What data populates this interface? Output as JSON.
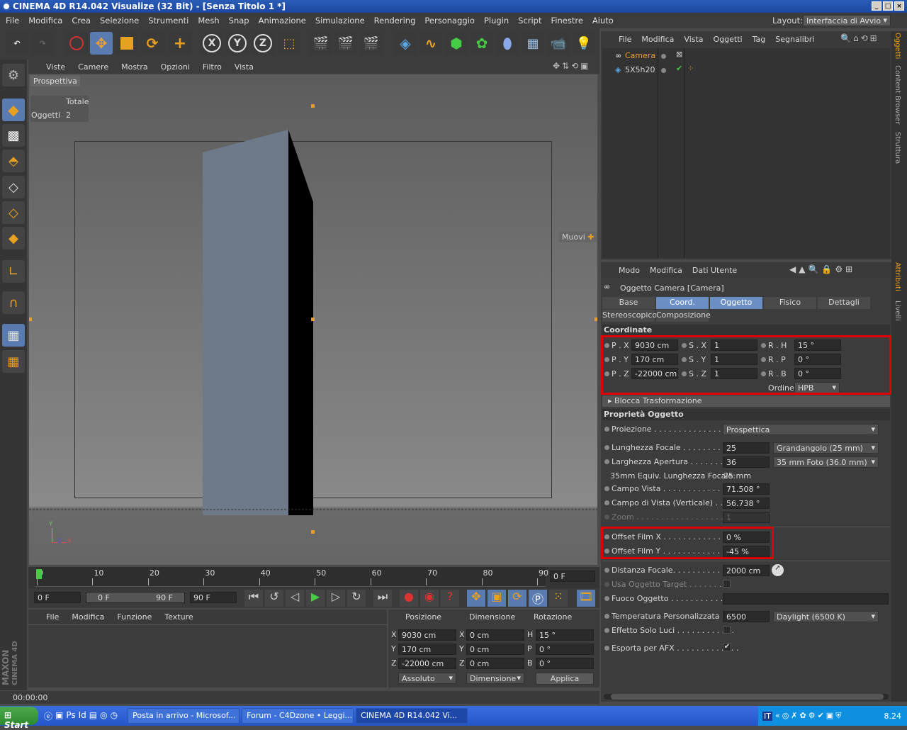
{
  "window": {
    "title": "CINEMA 4D R14.042 Visualize (32 Bit) - [Senza Titolo 1 *]",
    "layout_label": "Layout:",
    "layout_value": "Interfaccia di Avvio"
  },
  "menubar": [
    "File",
    "Modifica",
    "Crea",
    "Selezione",
    "Strumenti",
    "Mesh",
    "Snap",
    "Animazione",
    "Simulazione",
    "Rendering",
    "Personaggio",
    "Plugin",
    "Script",
    "Finestre",
    "Aiuto"
  ],
  "toolbar": {
    "axis_x": "X",
    "axis_y": "Y",
    "axis_z": "Z"
  },
  "viewport": {
    "menu": [
      "Viste",
      "Camere",
      "Mostra",
      "Opzioni",
      "Filtro",
      "Vista"
    ],
    "label": "Prospettiva",
    "hud_header": "Totale",
    "hud_row_label": "Oggetti",
    "hud_row_value": "2",
    "move_label": "Muovi",
    "axis_y": "Y",
    "axis_x": "X",
    "axis_z": "Z"
  },
  "timeline": {
    "ticks": [
      "0",
      "10",
      "20",
      "30",
      "40",
      "50",
      "60",
      "70",
      "80",
      "90"
    ],
    "frame_field": "0 F",
    "current_frame": 0,
    "max_frame": 90
  },
  "transport": {
    "start": "0 F",
    "range_start": "0 F",
    "range_end": "90 F",
    "end": "90 F"
  },
  "material": {
    "menu": [
      "File",
      "Modifica",
      "Funzione",
      "Texture"
    ]
  },
  "coords": {
    "headers": [
      "Posizione",
      "Dimensione",
      "Rotazione"
    ],
    "rows": [
      {
        "axis": "X",
        "pos": "9030 cm",
        "dim_axis": "X",
        "dim": "0 cm",
        "rot_axis": "H",
        "rot": "15 °"
      },
      {
        "axis": "Y",
        "pos": "170 cm",
        "dim_axis": "Y",
        "dim": "0 cm",
        "rot_axis": "P",
        "rot": "0 °"
      },
      {
        "axis": "Z",
        "pos": "-22000 cm",
        "dim_axis": "Z",
        "dim": "0 cm",
        "rot_axis": "B",
        "rot": "0 °"
      }
    ],
    "mode": "Assoluto",
    "dim_mode": "Dimensione",
    "apply": "Applica"
  },
  "status": {
    "time": "00:00:00"
  },
  "objmgr": {
    "menu": [
      "File",
      "Modifica",
      "Vista",
      "Oggetti",
      "Tag",
      "Segnalibri"
    ],
    "objects": [
      {
        "name": "Camera",
        "active": true
      },
      {
        "name": "5X5h20",
        "active": false
      }
    ]
  },
  "attr": {
    "menu": [
      "Modo",
      "Modifica",
      "Dati Utente"
    ],
    "title": "Oggetto Camera [Camera]",
    "tabs": [
      "Base",
      "Coord.",
      "Oggetto",
      "Fisico",
      "Dettagli",
      "Stereoscopico",
      "Composizione"
    ],
    "section_coord": "Coordinate",
    "coord_rows": [
      {
        "p_lbl": "P . X",
        "p": "9030 cm",
        "s_lbl": "S . X",
        "s": "1",
        "r_lbl": "R . H",
        "r": "15 °"
      },
      {
        "p_lbl": "P . Y",
        "p": "170 cm",
        "s_lbl": "S . Y",
        "s": "1",
        "r_lbl": "R . P",
        "r": "0 °"
      },
      {
        "p_lbl": "P . Z",
        "p": "-22000 cm",
        "s_lbl": "S . Z",
        "s": "1",
        "r_lbl": "R . B",
        "r": "0 °"
      }
    ],
    "order_label": "Ordine",
    "order_value": "HPB",
    "blocca": "Blocca Trasformazione",
    "section_obj": "Proprietà Oggetto",
    "proiezione_lbl": "Proiezione . . . . . . . . . . . . . . . . .",
    "proiezione": "Prospettica",
    "focale_lbl": "Lunghezza Focale . . . . . . . . . . .",
    "focale": "25",
    "focale_preset": "Grandangolo (25 mm)",
    "apertura_lbl": "Larghezza Apertura . . . . . . . . .",
    "apertura": "36",
    "apertura_preset": "35 mm Foto (36.0 mm)",
    "equiv_lbl": "35mm Equiv. Lunghezza Focale:",
    "equiv": "25 mm",
    "campo_lbl": "Campo Vista . . . . . . . . . . . . . . . .",
    "campo": "71.508 °",
    "campov_lbl": "Campo di Vista (Verticale) . . . . .",
    "campov": "56.738 °",
    "zoom_lbl": "Zoom . . . . . . . . . . . . . . . . . . . . .",
    "zoom": "1",
    "offx_lbl": "Offset Film X . . . . . . . . . . . . . .",
    "offx": "0 %",
    "offy_lbl": "Offset Film Y . . . . . . . . . . . . . .",
    "offy": "-45 %",
    "dist_lbl": "Distanza Focale. . . . . . . . . . . . .",
    "dist": "2000 cm",
    "target_lbl": "Usa Oggetto Target . . . . . . . . .",
    "fuoco_lbl": "Fuoco Oggetto . . . . . . . . . . . . . .",
    "temp_lbl": "Temperatura Personalizzata (K)",
    "temp": "6500",
    "temp_preset": "Daylight (6500 K)",
    "luci_lbl": "Effetto Solo Luci . . . . . . . . . . . .",
    "afx_lbl": "Esporta per AFX . . . . . . . . . . . . ."
  },
  "right_tabs": [
    "Oggetti",
    "Content Browser",
    "Struttura",
    "Attributi",
    "Livelli"
  ],
  "taskbar": {
    "start": "Start",
    "items": [
      "Posta in arrivo - Microsof...",
      "Forum - C4Dzone • Leggi...",
      "CINEMA 4D R14.042 Vi..."
    ],
    "lang": "IT",
    "clock": "8.24"
  },
  "logo": {
    "brand": "MAXON",
    "product": "CINEMA 4D"
  },
  "colors": {
    "accent": "#6b8fc4",
    "highlight": "#e00000",
    "active_object": "#f0a030"
  }
}
